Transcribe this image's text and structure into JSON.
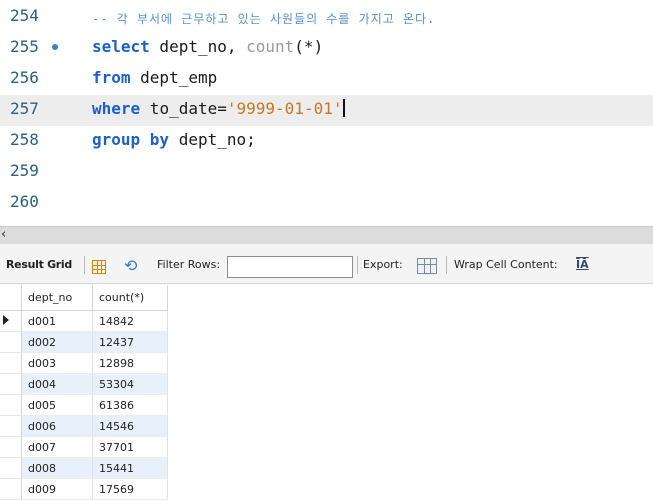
{
  "editor": {
    "lines": [
      {
        "number": "254",
        "comment": "-- 각 부서에 근무하고 있는 사원들의 수를 가지고 온다."
      },
      {
        "number": "255",
        "kw": "select",
        "rest": " dept_no, ",
        "fn": "count",
        "tail": "(*)"
      },
      {
        "number": "256",
        "kw": "from",
        "rest": " dept_emp"
      },
      {
        "number": "257",
        "kw": "where",
        "rest": " to_date=",
        "str": "'9999-01-01'"
      },
      {
        "number": "258",
        "kw": "group by",
        "rest": " dept_no;"
      },
      {
        "number": "259"
      },
      {
        "number": "260"
      }
    ]
  },
  "scrollbar": {
    "left_arrow": "‹"
  },
  "toolbar": {
    "result_grid": "Result Grid",
    "filter_rows": "Filter Rows:",
    "filter_value": "",
    "export": "Export:",
    "wrap_cell": "Wrap Cell Content:",
    "wrap_icon_text": "ĪĀ"
  },
  "grid": {
    "columns": [
      "dept_no",
      "count(*)"
    ],
    "rows": [
      [
        "d001",
        "14842"
      ],
      [
        "d002",
        "12437"
      ],
      [
        "d003",
        "12898"
      ],
      [
        "d004",
        "53304"
      ],
      [
        "d005",
        "61386"
      ],
      [
        "d006",
        "14546"
      ],
      [
        "d007",
        "37701"
      ],
      [
        "d008",
        "15441"
      ],
      [
        "d009",
        "17569"
      ]
    ]
  },
  "colors": {
    "keyword": "#1e5fc8",
    "string": "#c9771c",
    "comment": "#5a8fca",
    "line_number": "#2b5f83",
    "alt_row": "#e8f0fb"
  }
}
